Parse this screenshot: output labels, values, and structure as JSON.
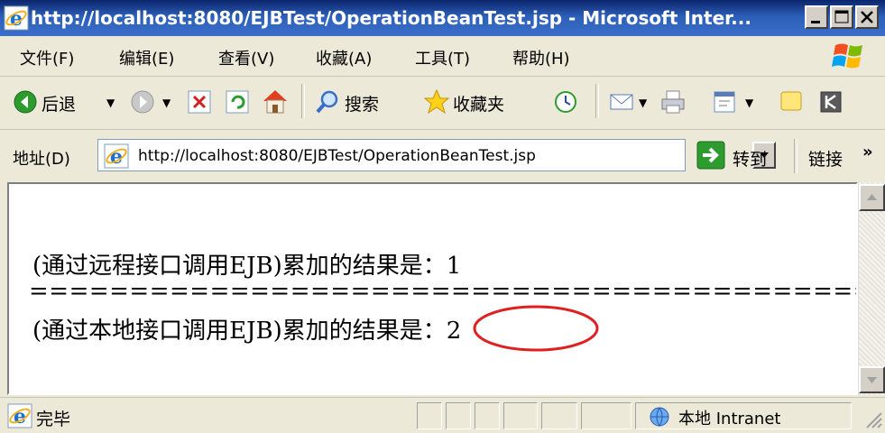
{
  "window": {
    "title": "http://localhost:8080/EJBTest/OperationBeanTest.jsp - Microsoft Inter..."
  },
  "menu": {
    "items": [
      "文件(F)",
      "编辑(E)",
      "查看(V)",
      "收藏(A)",
      "工具(T)",
      "帮助(H)"
    ]
  },
  "toolbar": {
    "back_label": "后退",
    "search_label": "搜索",
    "favorites_label": "收藏夹"
  },
  "address": {
    "label": "地址(D)",
    "url": "http://localhost:8080/EJBTest/OperationBeanTest.jsp",
    "go_label": "转到",
    "links_label": "链接",
    "links_chevron": "»"
  },
  "content": {
    "line1": "(通过远程接口调用EJB)累加的结果是：1",
    "separator": "=============================================",
    "line2": "(通过本地接口调用EJB)累加的结果是：2",
    "highlight_color": "#e02020"
  },
  "status": {
    "text": "完毕",
    "zone": "本地 Intranet"
  },
  "colors": {
    "titlebar": "#0a246a",
    "chrome": "#ece9d8"
  }
}
